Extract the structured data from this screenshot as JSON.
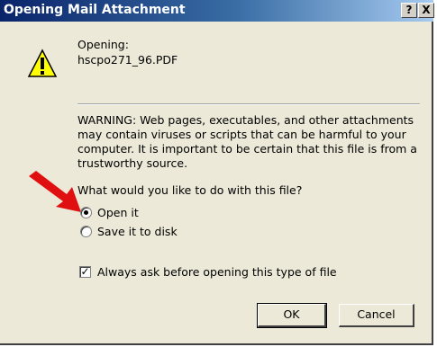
{
  "dialog": {
    "title": "Opening Mail Attachment",
    "help_label": "?",
    "close_label": "X",
    "opening_label": "Opening:",
    "filename": "hscpo271_96.PDF",
    "warning_text": "WARNING: Web pages, executables, and other attachments may contain viruses or scripts that can be harmful to your computer. It is important to be certain that this file is from a trustworthy source.",
    "question": "What would you like to do with this file?",
    "options": [
      {
        "label": "Open it",
        "selected": true
      },
      {
        "label": "Save it to disk",
        "selected": false
      }
    ],
    "always_ask_label": "Always ask before opening this type of file",
    "always_ask_checked": true,
    "ok_label": "OK",
    "cancel_label": "Cancel"
  },
  "colors": {
    "titlebar_start": "#0a246a",
    "titlebar_end": "#a6caf0",
    "dialog_bg": "#ece9d8",
    "arrow": "#e01010",
    "warning_yellow": "#ffff00"
  },
  "icons": {
    "warning": "warning-triangle-icon",
    "pointer_arrow": "red-arrow-icon"
  }
}
